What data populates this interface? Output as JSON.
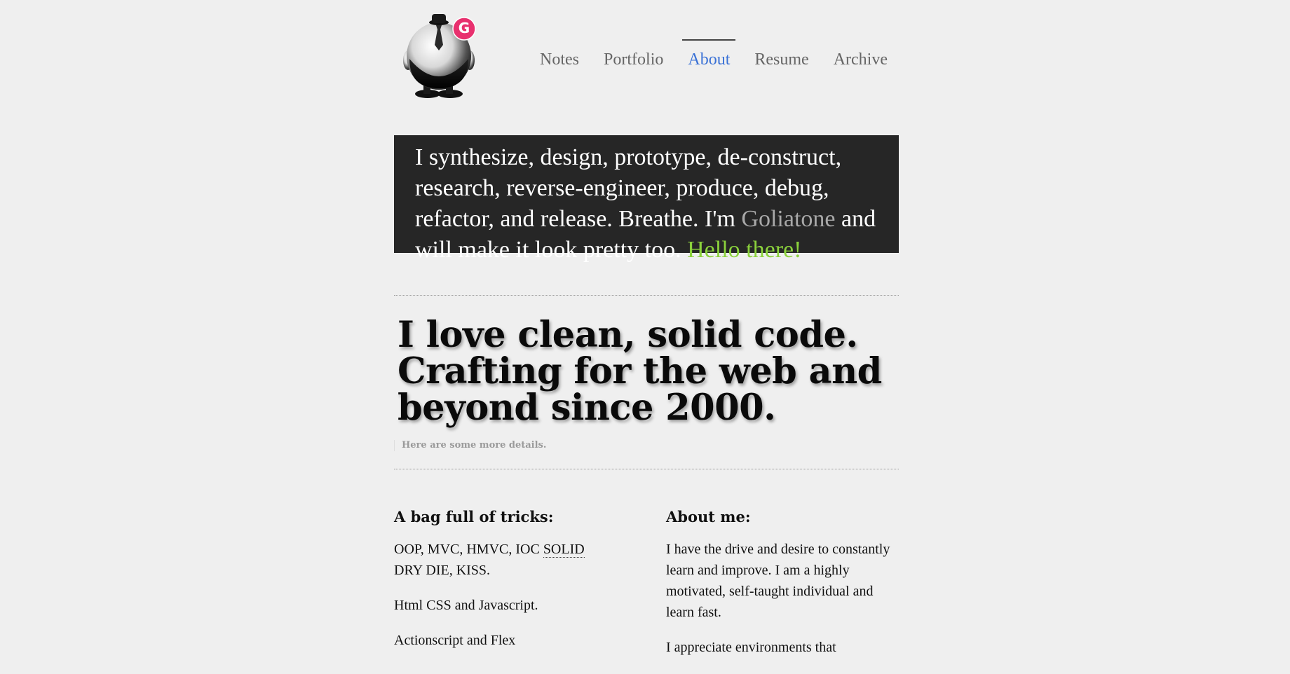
{
  "logo": {
    "badge_letter": "G",
    "badge_color": "#e8306e"
  },
  "nav": {
    "items": [
      {
        "label": "Notes",
        "active": false
      },
      {
        "label": "Portfolio",
        "active": false
      },
      {
        "label": "About",
        "active": true
      },
      {
        "label": "Resume",
        "active": false
      },
      {
        "label": "Archive",
        "active": false
      }
    ]
  },
  "banner": {
    "text": "I synthesize, design, prototype, de-construct, research, reverse-engineer, produce, debug, refactor, and release. Breathe. I'm ",
    "name": "Goliatone",
    "text2": " and will make it look pretty too. ",
    "hello": "Hello there!"
  },
  "headline": {
    "line1": "I love clean, solid code.",
    "line2": "Crafting for the web and",
    "line3": "beyond since 2000.",
    "details": "Here are some more details."
  },
  "tricks": {
    "title": "A bag full of tricks:",
    "p1_a": "OOP, MVC, HMVC, IOC ",
    "p1_abbr": "SOLID",
    "p1_b": "DRY DIE, KISS.",
    "p2": "Html CSS and Javascript.",
    "p3": "Actionscript and Flex"
  },
  "about": {
    "title": "About me:",
    "p1": "I have the drive and desire to constantly learn and improve. I am a highly motivated, self-taught individual and learn fast.",
    "p2": "I appreciate environments that"
  },
  "colors": {
    "background": "#efefef",
    "banner_bg": "#262626",
    "accent_link": "#3b72d6",
    "hello_green": "#8bd23c",
    "name_gray": "#a8a8a8"
  }
}
